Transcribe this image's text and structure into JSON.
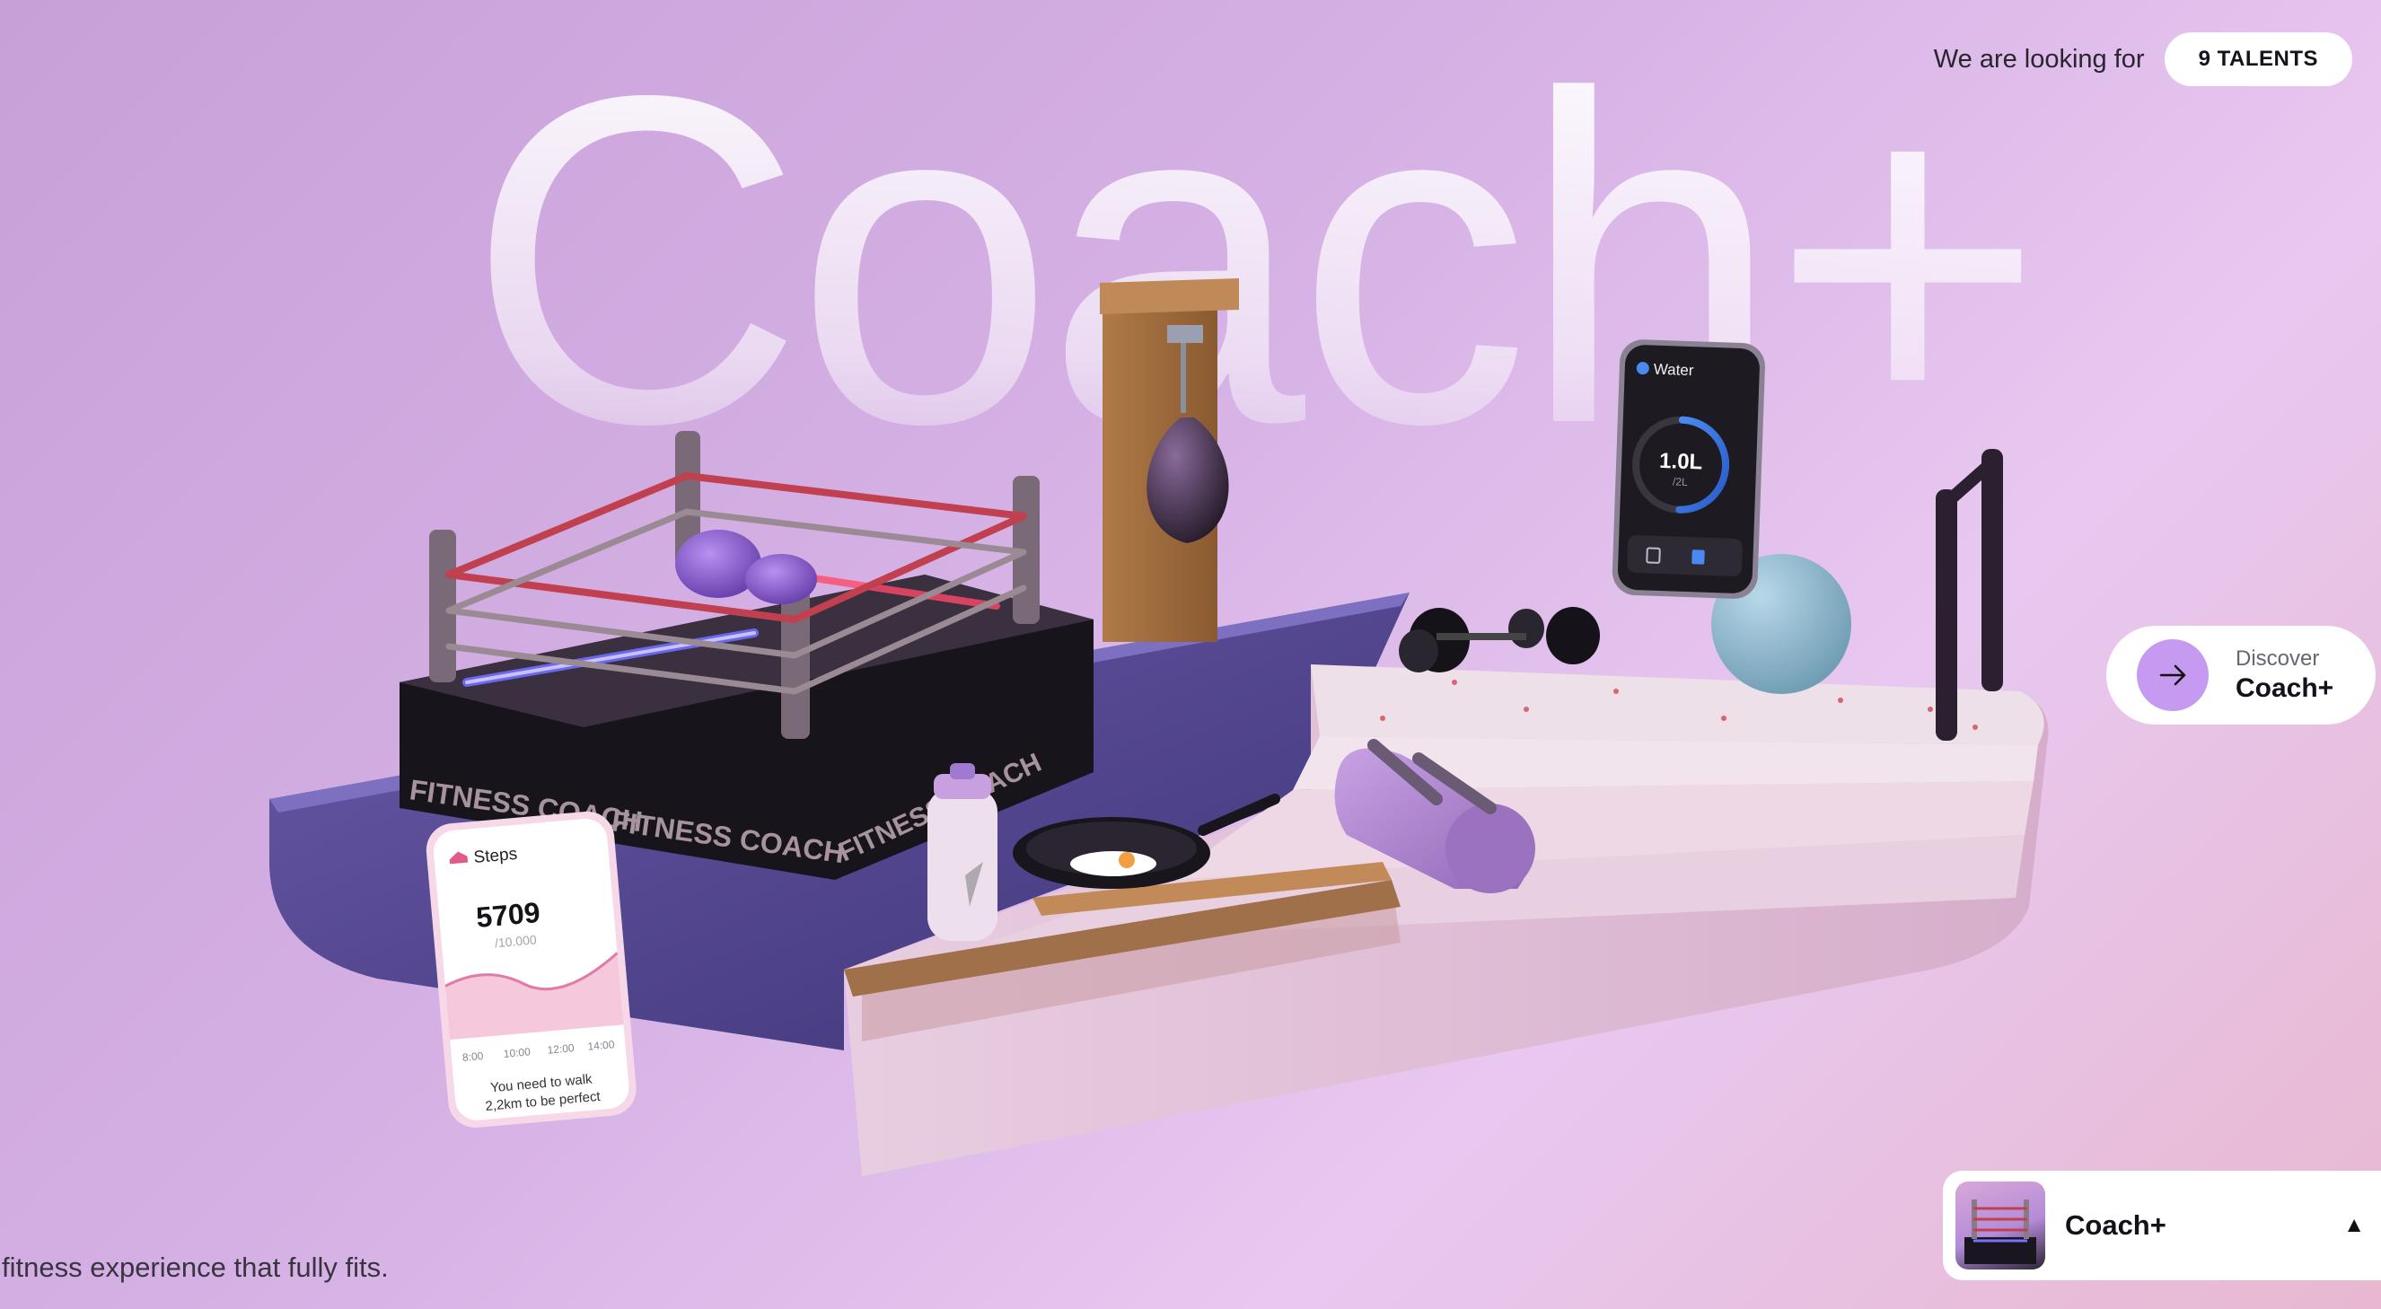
{
  "hero": {
    "word": "Coach+"
  },
  "header": {
    "looking_text": "We are looking for",
    "talents_label": "9 TALENTS"
  },
  "discover": {
    "small": "Discover",
    "big": "Coach+"
  },
  "footer": {
    "tagline": "fitness experience that fully fits."
  },
  "bottom_card": {
    "title": "Coach+",
    "caret": "▲"
  },
  "scene": {
    "ring_brand_front": "FITNESS COACH",
    "ring_brand_side": "FITNESS COACH",
    "steps_card": {
      "title": "Steps",
      "value": "5709",
      "goal": "/10.000",
      "times": [
        "8:00",
        "10:00",
        "12:00",
        "14:00"
      ],
      "message_line1": "You need to walk",
      "message_line2": "2,2km to be perfect"
    },
    "water_card": {
      "title": "Water",
      "value": "1.0L",
      "goal": "/2L",
      "progress": 0.5
    }
  },
  "colors": {
    "accent": "#c69af0",
    "ring_dark": "#17141c",
    "platform": "#4a3f84",
    "stairs": "#e8cde0"
  },
  "icons": [
    "arrow-right-icon",
    "shoe-icon",
    "water-drop-icon",
    "cup-icon"
  ]
}
